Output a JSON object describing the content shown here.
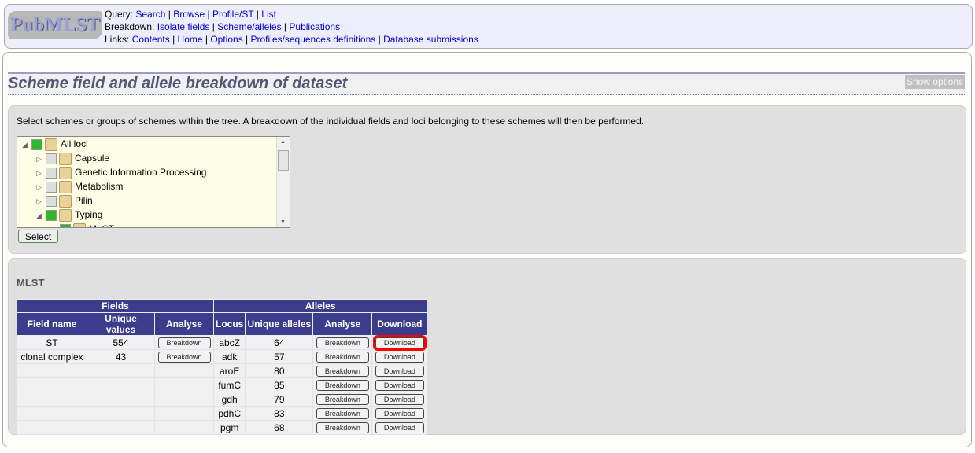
{
  "header": {
    "logo": "PubMLST",
    "query": {
      "label": "Query:",
      "links": [
        "Search",
        "Browse",
        "Profile/ST",
        "List"
      ]
    },
    "breakdown": {
      "label": "Breakdown:",
      "links": [
        "Isolate fields",
        "Scheme/alleles",
        "Publications"
      ]
    },
    "links": {
      "label": "Links:",
      "links": [
        "Contents",
        "Home",
        "Options",
        "Profiles/sequences definitions",
        "Database submissions"
      ]
    }
  },
  "page": {
    "title": "Scheme field and allele breakdown of dataset",
    "show_options": "Show options"
  },
  "selector": {
    "description": "Select schemes or groups of schemes within the tree. A breakdown of the individual fields and loci belonging to these schemes will then be performed.",
    "tree": [
      {
        "label": "All loci",
        "checked": true
      },
      {
        "label": "Capsule",
        "checked": false
      },
      {
        "label": "Genetic Information Processing",
        "checked": false
      },
      {
        "label": "Metabolism",
        "checked": false
      },
      {
        "label": "Pilin",
        "checked": false
      },
      {
        "label": "Typing",
        "checked": true
      },
      {
        "label": "MLST",
        "checked": true
      }
    ],
    "select_button": "Select"
  },
  "scheme": {
    "name": "MLST",
    "group_headers": [
      "Fields",
      "Alleles"
    ],
    "columns": [
      "Field name",
      "Unique values",
      "Analyse",
      "Locus",
      "Unique alleles",
      "Analyse",
      "Download"
    ],
    "fields": [
      {
        "name": "ST",
        "unique": "554",
        "action": "Breakdown"
      },
      {
        "name": "clonal complex",
        "unique": "43",
        "action": "Breakdown"
      }
    ],
    "alleles": [
      {
        "locus": "abcZ",
        "unique": "64"
      },
      {
        "locus": "adk",
        "unique": "57"
      },
      {
        "locus": "aroE",
        "unique": "80"
      },
      {
        "locus": "fumC",
        "unique": "85"
      },
      {
        "locus": "gdh",
        "unique": "79"
      },
      {
        "locus": "pdhC",
        "unique": "83"
      },
      {
        "locus": "pgm",
        "unique": "68"
      }
    ],
    "breakdown_label": "Breakdown",
    "download_label": "Download",
    "highlight_color": "#ff0000"
  }
}
